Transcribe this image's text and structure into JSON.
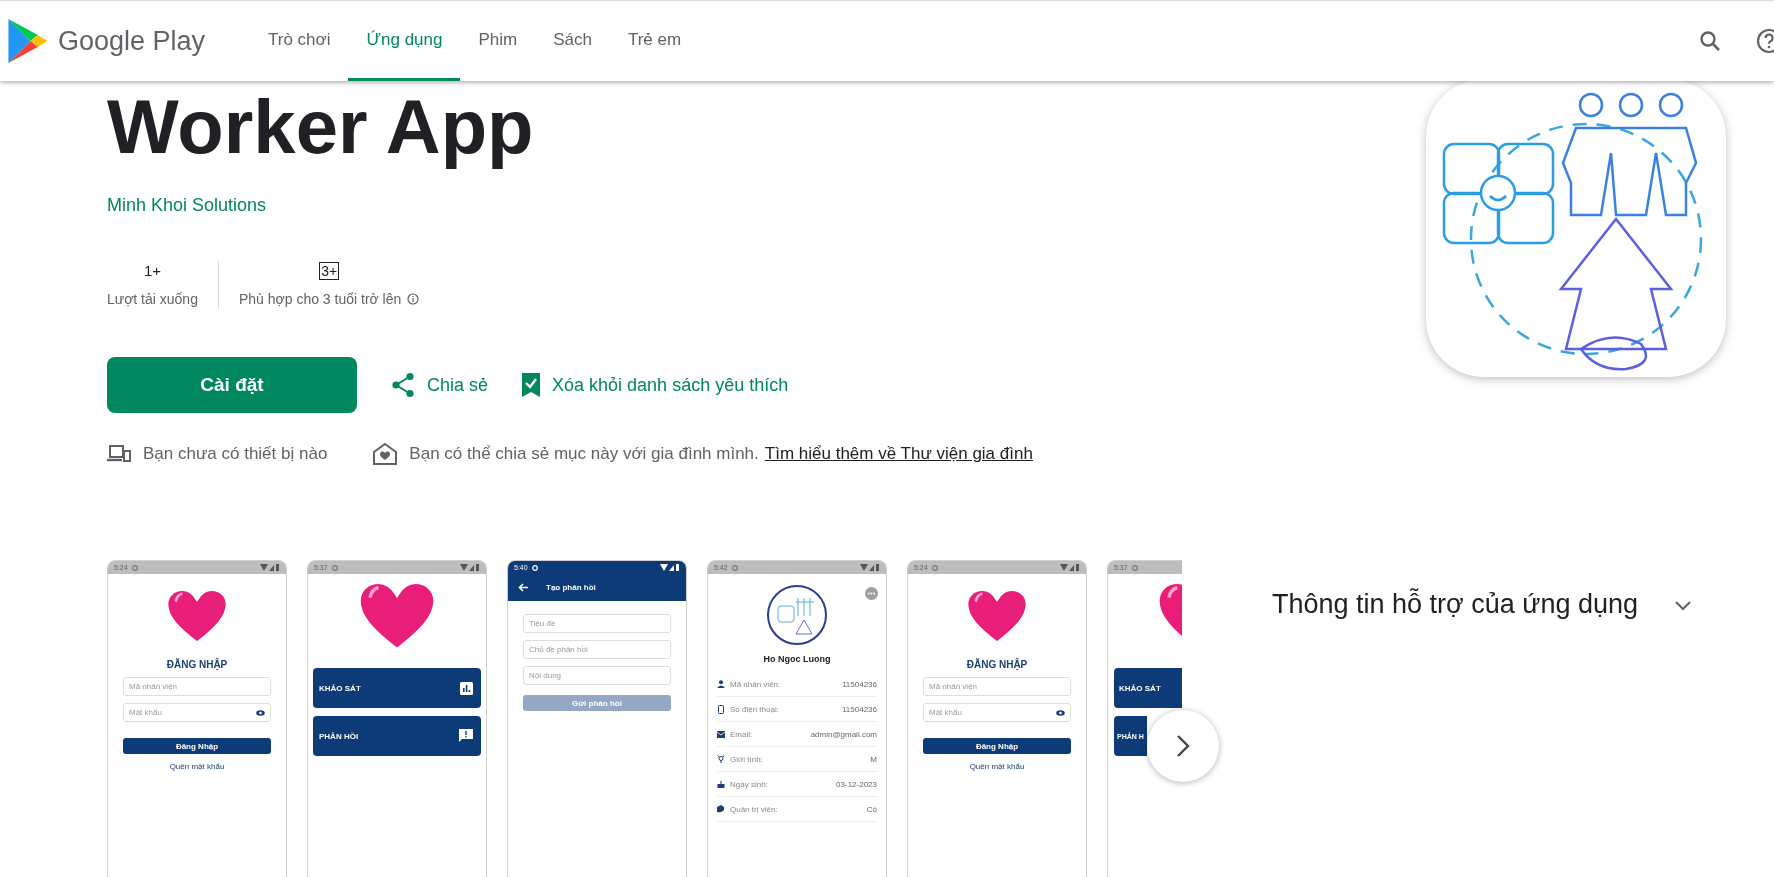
{
  "header": {
    "logo_text": "Google Play",
    "tabs": [
      {
        "label": "Trò chơi",
        "selected": false
      },
      {
        "label": "Ứng dụng",
        "selected": true
      },
      {
        "label": "Phim",
        "selected": false
      },
      {
        "label": "Sách",
        "selected": false
      },
      {
        "label": "Trẻ em",
        "selected": false
      }
    ]
  },
  "app": {
    "title": "Worker App",
    "developer": "Minh Khoi Solutions",
    "stats": [
      {
        "kind": "count",
        "value": "1+",
        "label": "Lượt tải xuống"
      },
      {
        "kind": "rating",
        "value": "3+",
        "label": "Phù hợp cho 3 tuổi trở lên"
      }
    ],
    "install_button": "Cài đặt",
    "share": "Chia sẻ",
    "wishlist": "Xóa khỏi danh sách yêu thích",
    "notices": [
      {
        "kind": "devices",
        "text": "Bạn chưa có thiết bị nào"
      },
      {
        "kind": "family",
        "text": "Bạn có thể chia sẻ mục này với gia đình mình.",
        "link": "Tìm hiểu thêm về Thư viện gia đình"
      }
    ]
  },
  "screenshots": [
    {
      "kind": "login",
      "time": "5:24",
      "heading": "ĐĂNG NHẬP",
      "fields": [
        {
          "kind": "text",
          "placeholder": "Mã nhân viên"
        },
        {
          "kind": "password",
          "placeholder": "Mật khẩu"
        }
      ],
      "button": "Đăng Nhập",
      "link": "Quên mật khẩu"
    },
    {
      "kind": "menu",
      "time": "5:37",
      "items": [
        {
          "kind": "survey",
          "label": "KHẢO SÁT"
        },
        {
          "kind": "feedback",
          "label": "PHẢN HỒI"
        }
      ]
    },
    {
      "kind": "form",
      "time": "5:40",
      "title": "Tạo phản hồi",
      "fields": [
        "Tiêu đề",
        "Chủ đề phản hồi",
        "Nội dung"
      ],
      "button": "Gửi phản hồi",
      "button_disabled": true
    },
    {
      "kind": "profile",
      "time": "5:42",
      "name": "Ho Ngoc Luong",
      "rows": [
        {
          "kind": "person",
          "label": "Mã nhân viên:",
          "value": "11504236"
        },
        {
          "kind": "phone",
          "label": "Số điện thoại:",
          "value": "11504236"
        },
        {
          "kind": "mail",
          "label": "Email:",
          "value": "admin@gmail.com"
        },
        {
          "kind": "gender",
          "label": "Giới tính:",
          "value": "M"
        },
        {
          "kind": "cake",
          "label": "Ngày sinh:",
          "value": "03-12-2023"
        },
        {
          "kind": "admin",
          "label": "Quản trị viên:",
          "value": "Có"
        }
      ]
    },
    {
      "kind": "login",
      "time": "5:24",
      "heading": "ĐĂNG NHẬP",
      "fields": [
        {
          "kind": "text",
          "placeholder": "Mã nhân viên"
        },
        {
          "kind": "password",
          "placeholder": "Mật khẩu"
        }
      ],
      "button": "Đăng Nhập",
      "link": "Quên mật khẩu"
    },
    {
      "kind": "menu",
      "time": "5:37",
      "items": [
        {
          "label": "KHẢO SÁT"
        },
        {
          "label": "PHẢN H"
        }
      ]
    }
  ],
  "support": {
    "title": "Thông tin hỗ trợ của ứng dụng",
    "expanded": false
  }
}
